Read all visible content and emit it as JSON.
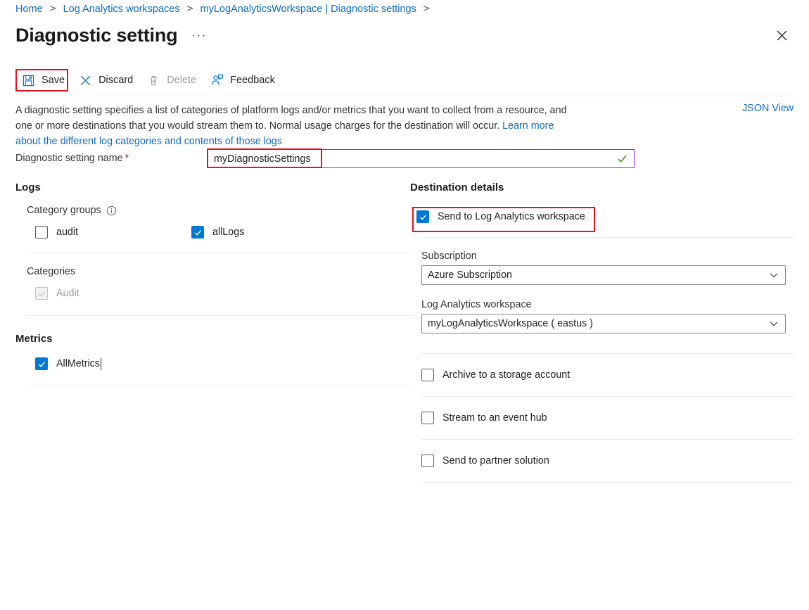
{
  "breadcrumb": {
    "items": [
      {
        "label": "Home",
        "icon": ""
      },
      {
        "label": "Log Analytics workspaces",
        "icon": ""
      },
      {
        "label": "myLogAnalyticsWorkspace | Diagnostic settings",
        "icon": ""
      }
    ],
    "separator": ">"
  },
  "header": {
    "title": "Diagnostic setting",
    "ellipsis": "···",
    "close_icon": "close-icon"
  },
  "toolbar": {
    "items": [
      {
        "label": "Save",
        "icon": "save-icon",
        "disabled": false,
        "highlighted": true
      },
      {
        "label": "Discard",
        "icon": "discard-x-icon",
        "disabled": false,
        "highlighted": false
      },
      {
        "label": "Delete",
        "icon": "trash-icon",
        "disabled": true,
        "highlighted": false
      },
      {
        "label": "Feedback",
        "icon": "feedback-person-icon",
        "disabled": false,
        "highlighted": false
      }
    ]
  },
  "description": {
    "text_part1": "A diagnostic setting specifies a list of categories of platform logs and/or metrics that you want to collect from a resource, and one or more destinations that you would stream them to. Normal usage charges for the destination will occur. ",
    "link_text": "Learn more about the different log categories and contents of those logs",
    "json_view_label": "JSON View"
  },
  "name_field": {
    "label": "Diagnostic setting name",
    "required_marker": "*",
    "value": "myDiagnosticSettings",
    "placeholder": "",
    "valid_icon": "green-check-icon"
  },
  "logs": {
    "section_title": "Logs",
    "category_groups": {
      "label": "Category groups",
      "info_icon": "info-icon",
      "items": [
        {
          "label": "audit",
          "checked": false,
          "disabled": false
        },
        {
          "label": "allLogs",
          "checked": true,
          "disabled": false
        }
      ]
    },
    "categories": {
      "label": "Categories",
      "items": [
        {
          "label": "Audit",
          "checked": true,
          "disabled": true
        }
      ]
    }
  },
  "metrics": {
    "section_title": "Metrics",
    "items": [
      {
        "label": "AllMetrics",
        "checked": true,
        "disabled": false,
        "has_caret": true
      }
    ]
  },
  "destination": {
    "section_title": "Destination details",
    "send_to_law": {
      "label": "Send to Log Analytics workspace",
      "checked": true,
      "highlighted": true
    },
    "subscription": {
      "label": "Subscription",
      "value": "Azure Subscription",
      "chevron_icon": "chevron-down-icon"
    },
    "workspace": {
      "label": "Log Analytics workspace",
      "value": "myLogAnalyticsWorkspace ( eastus )",
      "chevron_icon": "chevron-down-icon"
    },
    "other_options": [
      {
        "label": "Archive to a storage account",
        "checked": false
      },
      {
        "label": "Stream to an event hub",
        "checked": false
      },
      {
        "label": "Send to partner solution",
        "checked": false
      }
    ]
  },
  "colors": {
    "accent_blue": "#0078d4",
    "link_blue": "#0f6cbd",
    "highlight_red": "#e81123",
    "input_border_purple": "#8a2be2",
    "valid_green": "#498205",
    "disabled_gray": "#a19f9d"
  }
}
